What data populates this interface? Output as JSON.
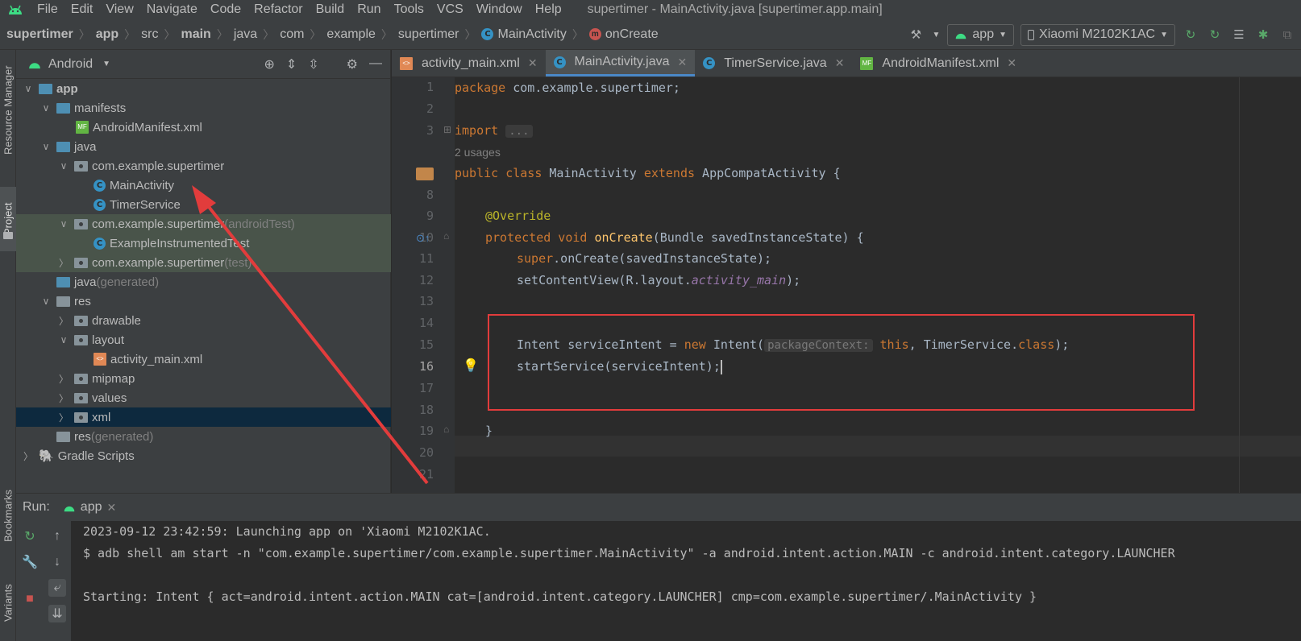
{
  "menubar": {
    "items": [
      "File",
      "Edit",
      "View",
      "Navigate",
      "Code",
      "Refactor",
      "Build",
      "Run",
      "Tools",
      "VCS",
      "Window",
      "Help"
    ],
    "window_title": "supertimer - MainActivity.java [supertimer.app.main]"
  },
  "breadcrumb": {
    "items": [
      "supertimer",
      "app",
      "src",
      "main",
      "java",
      "com",
      "example",
      "supertimer",
      "MainActivity",
      "onCreate"
    ]
  },
  "toolbar": {
    "run_config": "app",
    "device": "Xiaomi M2102K1AC"
  },
  "side_labels": {
    "resource_manager": "Resource Manager",
    "project": "Project",
    "bookmarks": "Bookmarks",
    "variants": "Variants"
  },
  "project": {
    "view": "Android",
    "tree": [
      {
        "label": "app",
        "suffix": ""
      },
      {
        "label": "manifests",
        "suffix": ""
      },
      {
        "label": "AndroidManifest.xml",
        "suffix": ""
      },
      {
        "label": "java",
        "suffix": ""
      },
      {
        "label": "com.example.supertimer",
        "suffix": ""
      },
      {
        "label": "MainActivity",
        "suffix": ""
      },
      {
        "label": "TimerService",
        "suffix": ""
      },
      {
        "label": "com.example.supertimer",
        "suffix": " (androidTest)"
      },
      {
        "label": "ExampleInstrumentedTest",
        "suffix": ""
      },
      {
        "label": "com.example.supertimer",
        "suffix": " (test)"
      },
      {
        "label": "java",
        "suffix": " (generated)"
      },
      {
        "label": "res",
        "suffix": ""
      },
      {
        "label": "drawable",
        "suffix": ""
      },
      {
        "label": "layout",
        "suffix": ""
      },
      {
        "label": "activity_main.xml",
        "suffix": ""
      },
      {
        "label": "mipmap",
        "suffix": ""
      },
      {
        "label": "values",
        "suffix": ""
      },
      {
        "label": "xml",
        "suffix": ""
      },
      {
        "label": "res",
        "suffix": " (generated)"
      },
      {
        "label": "Gradle Scripts",
        "suffix": ""
      }
    ]
  },
  "editor": {
    "tabs": [
      "activity_main.xml",
      "MainActivity.java",
      "TimerService.java",
      "AndroidManifest.xml"
    ],
    "active_tab": "MainActivity.java",
    "line_numbers": [
      "1",
      "2",
      "3",
      "7",
      "8",
      "9",
      "10",
      "11",
      "12",
      "13",
      "14",
      "15",
      "16",
      "17",
      "18",
      "19",
      "20",
      "21"
    ],
    "usage_hint": "2 usages",
    "code": {
      "l1_kw": "package",
      "l1_rest": " com.example.supertimer;",
      "l3_kw": "import",
      "l3_fold": "...",
      "l7_kw1": "public class",
      "l7_name": " MainActivity ",
      "l7_kw2": "extends",
      "l7_rest": " AppCompatActivity {",
      "l9_anno": "@Override",
      "l10_kw": "protected void",
      "l10_fn": "onCreate",
      "l10_rest": "(Bundle savedInstanceState) {",
      "l11_kw": "super",
      "l11_rest": ".onCreate(savedInstanceState);",
      "l12_a": "setContentView(R.layout.",
      "l12_it": "activity_main",
      "l12_b": ");",
      "l15_a": "Intent serviceIntent = ",
      "l15_kw": "new",
      "l15_b": " Intent(",
      "l15_hint": "packageContext:",
      "l15_this": "this",
      "l15_c": ", TimerService.",
      "l15_class": "class",
      "l15_d": ");",
      "l16": "startService(serviceIntent);",
      "l19": "}"
    }
  },
  "run": {
    "label": "Run:",
    "tab": "app",
    "console": [
      "2023-09-12 23:42:59: Launching app on 'Xiaomi M2102K1AC.",
      "$ adb shell am start -n \"com.example.supertimer/com.example.supertimer.MainActivity\" -a android.intent.action.MAIN -c android.intent.category.LAUNCHER",
      "",
      "Starting: Intent { act=android.intent.action.MAIN cat=[android.intent.category.LAUNCHER] cmp=com.example.supertimer/.MainActivity }"
    ]
  },
  "colors": {
    "accent": "#4a88c7",
    "annotation_box": "#e23c3c",
    "android_green": "#3ddc84"
  }
}
